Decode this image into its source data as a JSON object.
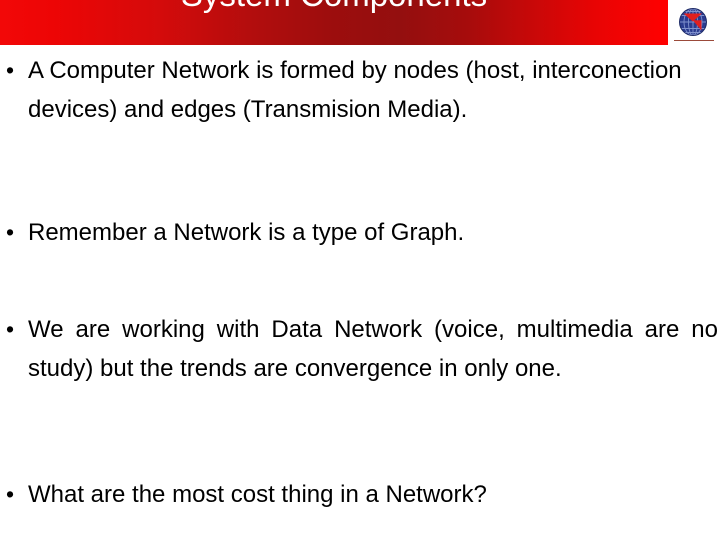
{
  "slide": {
    "title": "System Components",
    "title_color": "#ffffff",
    "banner_color_left": "#f20808",
    "banner_color_mid": "#9c0d0d",
    "banner_color_right": "#ff0000",
    "background_color": "#ffffff",
    "text_color": "#000000"
  },
  "logo": {
    "name": "globe-logo",
    "globe_color": "#2a3b8f",
    "accent_color": "#e02020",
    "underline_color": "#9b4a3a"
  },
  "bullets": [
    {
      "marker": "•",
      "text": "A Computer Network is formed by nodes (host, interconection devices) and edges (Transmision Media)."
    },
    {
      "marker": "•",
      "text": "Remember a Network is a type of Graph."
    },
    {
      "marker": "•",
      "text": "We are working with Data Network (voice, multimedia are no study) but the trends are convergence in only one."
    },
    {
      "marker": "•",
      "text": "What are the most cost thing in a Network?"
    }
  ]
}
